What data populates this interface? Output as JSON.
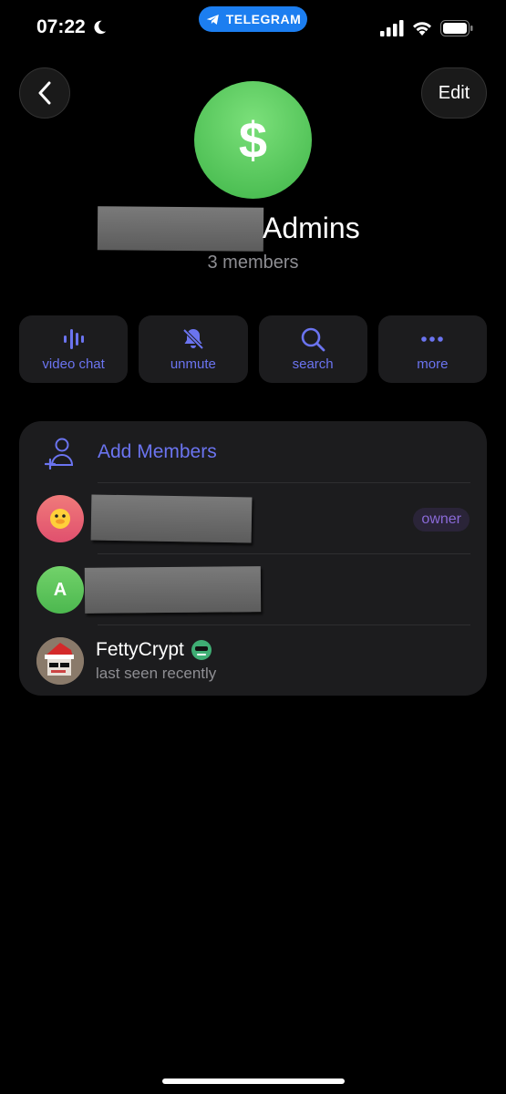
{
  "status_bar": {
    "time": "07:22",
    "app_pill": "TELEGRAM"
  },
  "header": {
    "edit_label": "Edit"
  },
  "group": {
    "avatar_symbol": "$",
    "name": "Admins",
    "member_count": "3 members"
  },
  "actions": [
    {
      "label": "video chat",
      "icon": "waveform-icon"
    },
    {
      "label": "unmute",
      "icon": "bell-slash-icon"
    },
    {
      "label": "search",
      "icon": "search-icon"
    },
    {
      "label": "more",
      "icon": "ellipsis-icon"
    }
  ],
  "members_section": {
    "add_label": "Add Members",
    "members": [
      {
        "name": "",
        "role": "owner",
        "avatar_color": "#e8617a"
      },
      {
        "name": "",
        "avatar_letter": "A",
        "avatar_color": "#5ec75a"
      },
      {
        "name": "FettyCrypt",
        "status": "last seen recently"
      }
    ]
  },
  "colors": {
    "accent": "#6b74f0",
    "telegram_blue": "#1c7ef0",
    "green": "#4cc25a"
  }
}
